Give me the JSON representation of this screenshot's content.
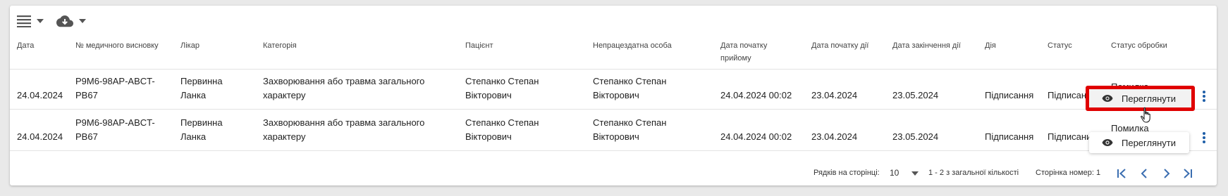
{
  "toolbar": {
    "list_icon": "list-icon",
    "download_icon": "cloud-download-icon"
  },
  "columns": [
    "Дата",
    "№ медичного висновку",
    "Лікар",
    "Категорія",
    "Пацієнт",
    "Непрацездатна особа",
    "Дата початку прийому",
    "Дата початку дії",
    "Дата закінчення дії",
    "Дія",
    "Статус",
    "Статус обробки"
  ],
  "rows": [
    {
      "date": "24.04.2024",
      "number_1": "P9M6-98AP-ABCT-",
      "number_2": "PB67",
      "doctor_1": "Первинна",
      "doctor_2": "Ланка",
      "category_1": "Захворювання або травма загального",
      "category_2": "характеру",
      "patient_1": "Степанко Степан",
      "patient_2": "Вікторович",
      "disabled_1": "Степанко Степан",
      "disabled_2": "Вікторович",
      "reception_start": "24.04.2024 00:02",
      "start": "23.04.2024",
      "end": "23.05.2024",
      "action": "Підписання",
      "status": "Підписан",
      "processing": "Помилка"
    },
    {
      "date": "24.04.2024",
      "number_1": "P9M6-98AP-ABCT-",
      "number_2": "PB67",
      "doctor_1": "Первинна",
      "doctor_2": "Ланка",
      "category_1": "Захворювання або травма загального",
      "category_2": "характеру",
      "patient_1": "Степанко Степан",
      "patient_2": "Вікторович",
      "disabled_1": "Степанко Степан",
      "disabled_2": "Вікторович",
      "reception_start": "24.04.2024 00:02",
      "start": "23.04.2024",
      "end": "23.05.2024",
      "action": "Підписання",
      "status": "Підписаний",
      "processing": "Помилка"
    }
  ],
  "view_button": {
    "label": "Переглянути",
    "icon": "eye-icon"
  },
  "menu_item": {
    "label": "Переглянути",
    "icon": "eye-icon"
  },
  "footer": {
    "rows_per_page_label": "Рядків на сторінці:",
    "rows_per_page_value": "10",
    "range_text": "1 - 2 з загальної кількості",
    "page_label": "Сторінка номер: 1"
  },
  "colors": {
    "accent": "#1f5ea8",
    "highlight": "#e00000"
  }
}
